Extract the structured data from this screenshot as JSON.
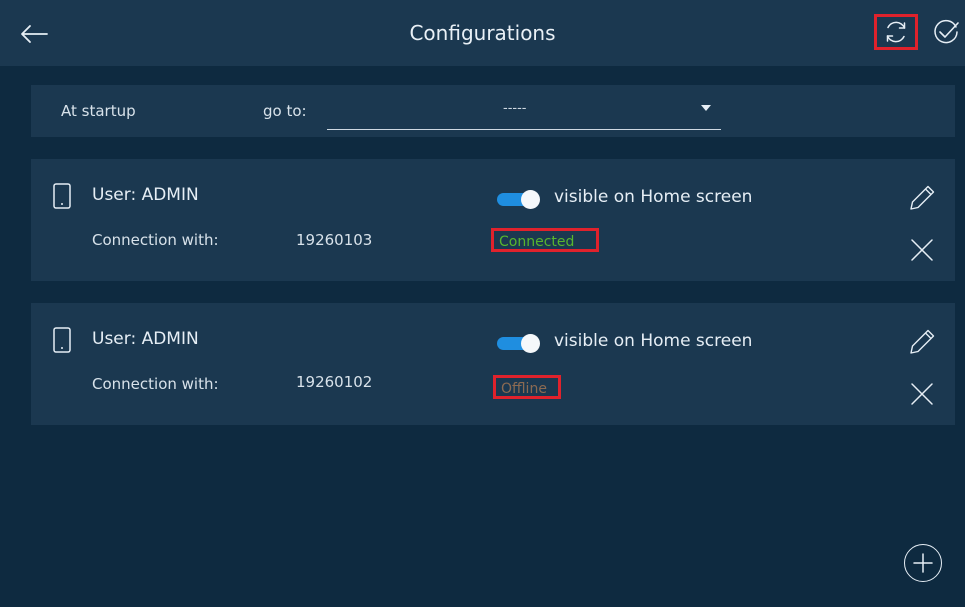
{
  "header": {
    "title": "Configurations",
    "back_icon": "arrow-left-icon",
    "refresh_icon": "refresh-icon",
    "confirm_icon": "check-circle-icon"
  },
  "startup": {
    "label": "At startup",
    "goto_label": "go to:",
    "goto_value": "-----"
  },
  "configurations": [
    {
      "user": "User: ADMIN",
      "visible_label": "visible on Home screen",
      "visible_on": true,
      "connection_label": "Connection with:",
      "connection_id": "19260103",
      "status": "Connected"
    },
    {
      "user": "User: ADMIN",
      "visible_label": "visible on Home screen",
      "visible_on": true,
      "connection_label": "Connection with:",
      "connection_id": "19260102",
      "status": "Offline"
    }
  ],
  "colors": {
    "background": "#0e2a40",
    "panel": "#1b3850",
    "toggle_on": "#1f8ee0",
    "connected": "#57b52e",
    "offline": "#8b6a52",
    "highlight": "#e0222c"
  }
}
